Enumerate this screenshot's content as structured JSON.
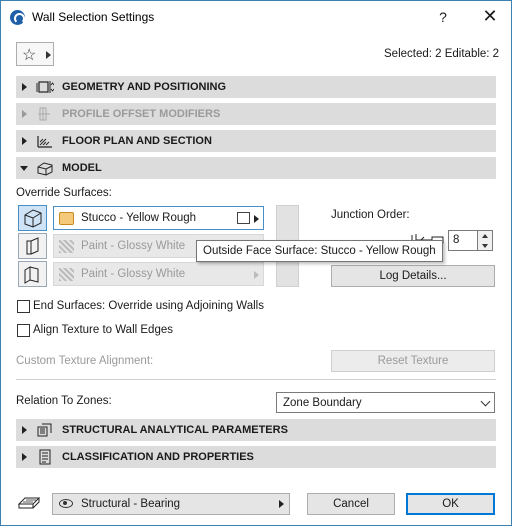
{
  "window": {
    "title": "Wall Selection Settings",
    "help": "?",
    "close": "✕"
  },
  "header": {
    "star": "☆",
    "selection_info": "Selected: 2 Editable: 2"
  },
  "sections": {
    "geometry": "GEOMETRY AND POSITIONING",
    "profile": "PROFILE OFFSET MODIFIERS",
    "floorplan": "FLOOR PLAN AND SECTION",
    "model": "MODEL",
    "structural": "STRUCTURAL ANALYTICAL PARAMETERS",
    "classification": "CLASSIFICATION AND PROPERTIES"
  },
  "model": {
    "override_label": "Override Surfaces:",
    "surfaces": [
      {
        "label": "Stucco - Yellow Rough",
        "active": true
      },
      {
        "label": "Paint - Glossy White",
        "active": false
      },
      {
        "label": "Paint - Glossy White",
        "active": false
      }
    ],
    "junction_label": "Junction Order:",
    "junction_value": "8",
    "log_details": "Log Details...",
    "end_surfaces": "End Surfaces: Override using Adjoining Walls",
    "align_texture": "Align Texture to Wall Edges",
    "custom_alignment": "Custom Texture Alignment:",
    "reset_texture": "Reset Texture",
    "tooltip": "Outside Face Surface: Stucco - Yellow Rough"
  },
  "zones": {
    "label": "Relation To Zones:",
    "value": "Zone Boundary"
  },
  "footer": {
    "structural": "Structural - Bearing",
    "cancel": "Cancel",
    "ok": "OK"
  },
  "colors": {
    "accent": "#0078d7",
    "section_bg": "#dcdcdc",
    "swatch": "#f5c97a"
  }
}
